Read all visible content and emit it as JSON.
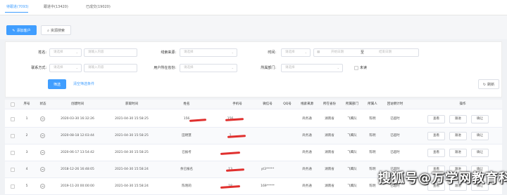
{
  "tabs": [
    {
      "label": "待跟进(7093)"
    },
    {
      "label": "跟进中(13420)"
    },
    {
      "label": "已成交(19020)"
    }
  ],
  "toolbar": {
    "add_label": "添加客户",
    "search_label": "资源搜索"
  },
  "filters": {
    "name_label": "姓名:",
    "name_select": "请选择",
    "name_input": "请输入内容",
    "source_label": "线索来源:",
    "source_select": "请选择",
    "time_label": "时间:",
    "time_select": "请选择",
    "start_placeholder": "开始日期",
    "range_sep": "至",
    "end_placeholder": "结束日期",
    "contact_label": "联系方式:",
    "contact_select": "请选择",
    "contact_input": "请输入内容",
    "province_label": "用户所在省份:",
    "province_select": "请选择",
    "dept_label": "所属部门:",
    "dept_select": "请选择",
    "unread_label": "未读",
    "filter_button": "筛选",
    "clear_link": "清空筛选条件",
    "refresh_button": "刷新"
  },
  "table": {
    "headers": [
      "序号",
      "状态",
      "创建时间",
      "获取时间",
      "姓名",
      "手机号",
      "微信号",
      "QQ号",
      "线索来源",
      "所在省份",
      "所属部门",
      "所属人",
      "回访倒计时",
      "操作"
    ],
    "rows": [
      {
        "no": "1",
        "created": "2020-03-30 16:32:26",
        "fetched": "2021-04-30 15:58:25",
        "name": "156",
        "phone": "156",
        "wechat": "",
        "qq": "",
        "source": "商务通",
        "province": "湖南省",
        "dept": "飞鹰队",
        "owner": "陈明",
        "countdown": "已超时"
      },
      {
        "no": "2",
        "created": "2020-08-18 12:03:44",
        "fetched": "2021-04-30 15:58:25",
        "name": "田明慧",
        "phone": "1",
        "wechat": "",
        "qq": "",
        "source": "商务通",
        "province": "湖南省",
        "dept": "飞鹰队",
        "owner": "陈明",
        "countdown": "已超时"
      },
      {
        "no": "3",
        "created": "2020-06-17 13:54:42",
        "fetched": "2021-04-30 15:58:25",
        "name": "已报考",
        "phone": "",
        "wechat": "",
        "qq": "",
        "source": "商务通",
        "province": "湖南省",
        "dept": "飞鹰队",
        "owner": "陈明",
        "countdown": "已超时"
      },
      {
        "no": "4",
        "created": "2018-12-26 16:48:05",
        "fetched": "2021-04-30 15:58:24",
        "name": "余已报名",
        "phone": "13",
        "wechat": "yt3*****",
        "qq": "",
        "source": "商务通",
        "province": "湖南省",
        "dept": "飞鹰队",
        "owner": "陈明",
        "countdown": "已超时"
      },
      {
        "no": "5",
        "created": "2019-11-20 00:00:00",
        "fetched": "2021-04-30 15:58:24",
        "name": "陈晓莉",
        "phone": "18",
        "wechat": "169*****",
        "qq": "",
        "source": "商务通",
        "province": "湖南省",
        "dept": "飞鹰队",
        "owner": "陈明",
        "countdown": "已超时"
      }
    ],
    "actions": {
      "view": "查看",
      "follow": "跟进",
      "confirm": "确让"
    }
  },
  "watermark": "搜狐号@万学网教育科技",
  "colors": {
    "accent": "#409eff",
    "redaction": "#e0302e"
  }
}
